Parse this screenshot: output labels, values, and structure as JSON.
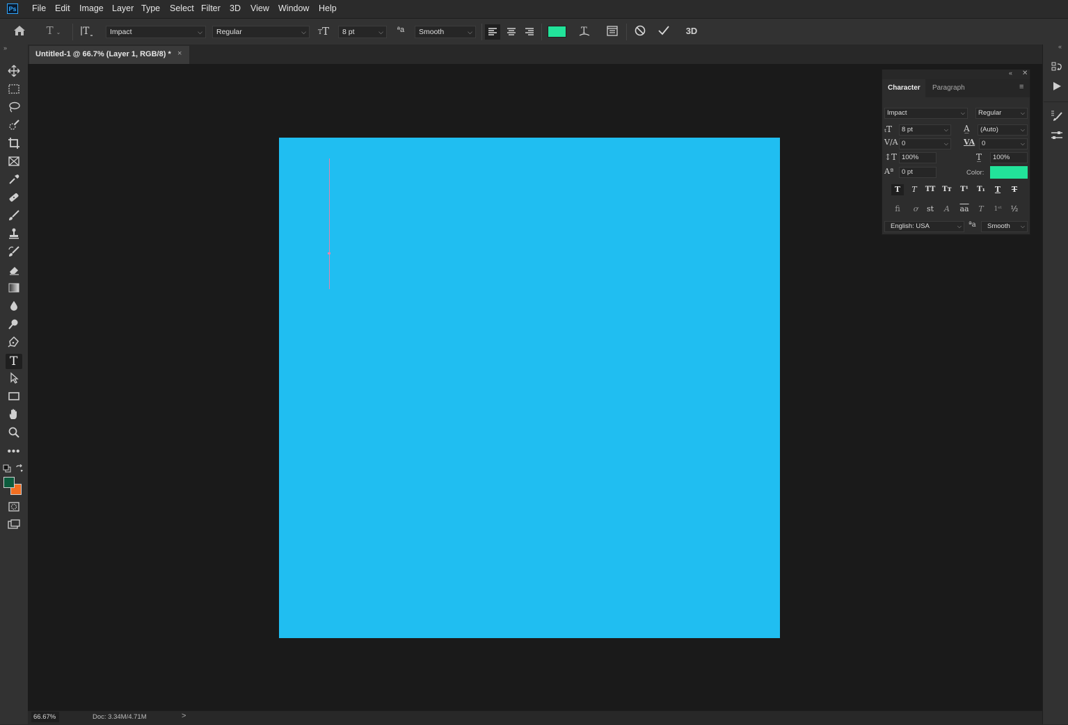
{
  "app": {
    "logo_text": "Ps",
    "menu": [
      "File",
      "Edit",
      "Image",
      "Layer",
      "Type",
      "Select",
      "Filter",
      "3D",
      "View",
      "Window",
      "Help"
    ]
  },
  "options_bar": {
    "font_family": "Impact",
    "font_style": "Regular",
    "font_size": "8 pt",
    "antialias": "Smooth",
    "text_color": "#22e39a",
    "three_d_label": "3D"
  },
  "document": {
    "tab_title": "Untitled-1 @ 66.7% (Layer 1, RGB/8) *",
    "close_glyph": "×",
    "canvas_color": "#20bef1",
    "cursor_color": "#e384ad"
  },
  "toolbar": {
    "foreground_color": "#0c5b3d",
    "background_color": "#f26f22"
  },
  "status": {
    "zoom": "66.67%",
    "doc_info": "Doc: 3.34M/4.71M",
    "arrow": ">"
  },
  "character_panel": {
    "tabs": [
      "Character",
      "Paragraph"
    ],
    "font_family": "Impact",
    "font_style": "Regular",
    "font_size": "8 pt",
    "leading": "(Auto)",
    "kerning": "0",
    "tracking": "0",
    "vertical_scale": "100%",
    "horizontal_scale": "100%",
    "baseline_shift": "0 pt",
    "color_label": "Color:",
    "color": "#22e39a",
    "language": "English: USA",
    "antialias": "Smooth"
  }
}
